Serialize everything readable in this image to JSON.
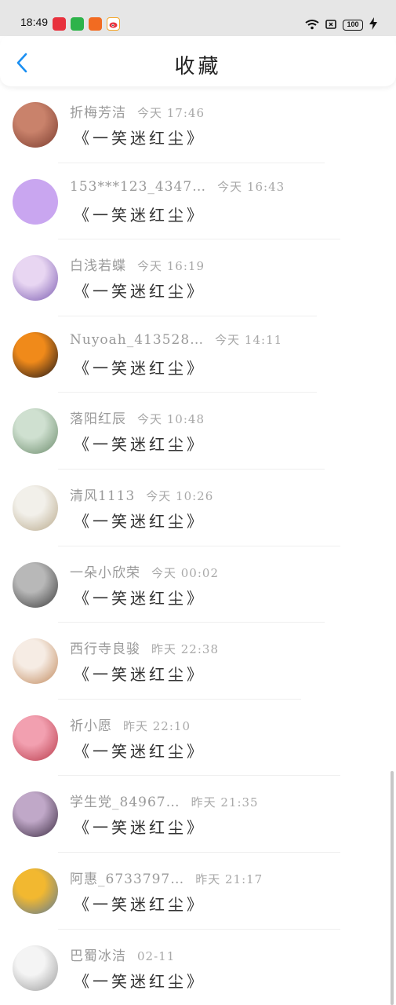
{
  "status_bar": {
    "time": "18:49",
    "battery": "100",
    "apps": [
      {
        "icon": "red-app-icon",
        "text": "",
        "color": "#e8313d"
      },
      {
        "icon": "green-app-icon",
        "text": "",
        "color": "#2db34a"
      },
      {
        "icon": "orange-app-icon",
        "text": "",
        "color": "#f26b21"
      },
      {
        "icon": "weibo-icon",
        "text": "",
        "color": "#f4a62a"
      }
    ]
  },
  "header": {
    "title": "收藏",
    "accent": "#1a8ff2"
  },
  "items": [
    {
      "name": "折梅芳洁",
      "time": "今天 17:46",
      "book": "《一笑迷红尘》",
      "avatar_colors": [
        "#c9826b",
        "#7a3b2e"
      ]
    },
    {
      "name": "153***123_4347…",
      "time": "今天 16:43",
      "book": "《一笑迷红尘》",
      "avatar_colors": [
        "#c9a6f0",
        "#c9a6f0"
      ]
    },
    {
      "name": "白浅若蝶",
      "time": "今天 16:19",
      "book": "《一笑迷红尘》",
      "avatar_colors": [
        "#e8d6f2",
        "#7a5ab0"
      ]
    },
    {
      "name": "Nuyoah_413528…",
      "time": "今天 14:11",
      "book": "《一笑迷红尘》",
      "avatar_colors": [
        "#f08a1a",
        "#1a1418"
      ]
    },
    {
      "name": "落阳红辰",
      "time": "今天 10:48",
      "book": "《一笑迷红尘》",
      "avatar_colors": [
        "#cfe0d0",
        "#6a8a6a"
      ]
    },
    {
      "name": "清风1113",
      "time": "今天 10:26",
      "book": "《一笑迷红尘》",
      "avatar_colors": [
        "#f2f0ea",
        "#b8a88a"
      ]
    },
    {
      "name": "一朵小欣荣",
      "time": "今天 00:02",
      "book": "《一笑迷红尘》",
      "avatar_colors": [
        "#b8b8b8",
        "#3a3a3a"
      ]
    },
    {
      "name": "西行寺良骏",
      "time": "昨天 22:38",
      "book": "《一笑迷红尘》",
      "avatar_colors": [
        "#f6ece4",
        "#c0885a"
      ]
    },
    {
      "name": "祈小愿",
      "time": "昨天 22:10",
      "book": "《一笑迷红尘》",
      "avatar_colors": [
        "#f2a0b0",
        "#b83a4a"
      ]
    },
    {
      "name": "学生党_84967…",
      "time": "昨天 21:35",
      "book": "《一笑迷红尘》",
      "avatar_colors": [
        "#c0a8c8",
        "#3a2a40"
      ]
    },
    {
      "name": "阿惠_6733797…",
      "time": "昨天 21:17",
      "book": "《一笑迷红尘》",
      "avatar_colors": [
        "#f2b830",
        "#5a7a9a"
      ]
    },
    {
      "name": "巴蜀冰洁",
      "time": "02-11",
      "book": "《一笑迷红尘》",
      "avatar_colors": [
        "#f4f4f4",
        "#9a9a9a"
      ]
    }
  ]
}
